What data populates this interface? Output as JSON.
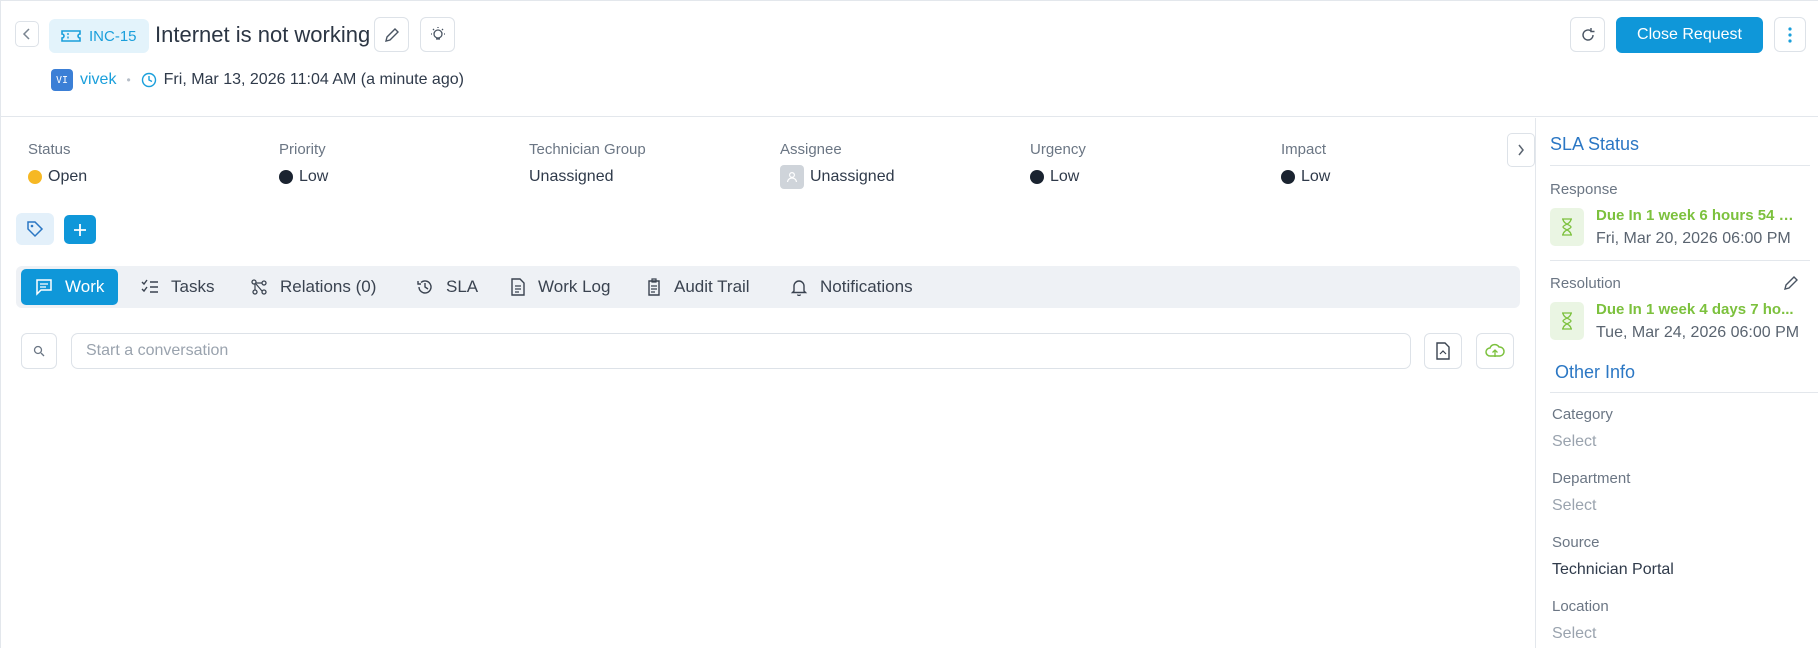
{
  "header": {
    "ticket_id": "INC-15",
    "title": "Internet is not working",
    "author_initials": "VI",
    "author": "vivek",
    "timestamp": "Fri, Mar 13, 2026 11:04 AM (a minute ago)",
    "close_button": "Close Request"
  },
  "fields": [
    {
      "label": "Status",
      "value": "Open",
      "dot_color": "#f6b824"
    },
    {
      "label": "Priority",
      "value": "Low",
      "dot_color": "#1a2330"
    },
    {
      "label": "Technician Group",
      "value": "Unassigned"
    },
    {
      "label": "Assignee",
      "value": "Unassigned"
    },
    {
      "label": "Urgency",
      "value": "Low",
      "dot_color": "#1a2330"
    },
    {
      "label": "Impact",
      "value": "Low",
      "dot_color": "#1a2330"
    }
  ],
  "tabs": [
    {
      "label": "Work",
      "icon": "chat-icon",
      "active": true
    },
    {
      "label": "Tasks",
      "icon": "checklist-icon"
    },
    {
      "label": "Relations (0)",
      "icon": "relations-icon"
    },
    {
      "label": "SLA",
      "icon": "history-icon"
    },
    {
      "label": "Work Log",
      "icon": "document-icon"
    },
    {
      "label": "Audit Trail",
      "icon": "clipboard-icon"
    },
    {
      "label": "Notifications",
      "icon": "bell-icon"
    }
  ],
  "composer": {
    "placeholder": "Start a conversation"
  },
  "sidebar": {
    "sla_heading": "SLA Status",
    "response_label": "Response",
    "response_due": "Due In 1 week 6 hours 54 mi...",
    "response_date": "Fri, Mar 20, 2026 06:00 PM",
    "resolution_label": "Resolution",
    "resolution_due": "Due In 1 week 4 days 7 ho...",
    "resolution_date": "Tue, Mar 24, 2026 06:00 PM",
    "other_heading": "Other Info",
    "category_label": "Category",
    "category_value": "Select",
    "department_label": "Department",
    "department_value": "Select",
    "source_label": "Source",
    "source_value": "Technician Portal",
    "location_label": "Location",
    "location_value": "Select"
  },
  "colors": {
    "accent": "#0f97d9",
    "link": "#1a9fdb",
    "sla_green": "#7cc13d",
    "heading_blue": "#2b77c4"
  }
}
